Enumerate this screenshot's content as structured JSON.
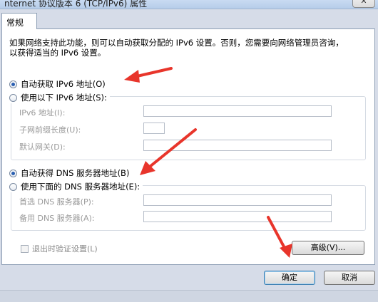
{
  "window": {
    "title": "nternet 协议版本 6 (TCP/IPv6) 属性",
    "close_glyph": "✕"
  },
  "tab": {
    "label": "常规"
  },
  "intro_text": "如果网络支持此功能，则可以自动获取分配的 IPv6 设置。否则，您需要向网络管理员咨询，以获得适当的 IPv6 设置。",
  "ip_section": {
    "auto_label": "自动获取 IPv6 地址(O)",
    "auto_selected": true,
    "manual_label": "使用以下 IPv6 地址(S):",
    "fields": [
      {
        "label": "IPv6 地址(I):",
        "value": ""
      },
      {
        "label": "子网前缀长度(U):",
        "value": ""
      },
      {
        "label": "默认网关(D):",
        "value": ""
      }
    ]
  },
  "dns_section": {
    "auto_label": "自动获得 DNS 服务器地址(B)",
    "auto_selected": true,
    "manual_label": "使用下面的 DNS 服务器地址(E):",
    "fields": [
      {
        "label": "首选 DNS 服务器(P):",
        "value": ""
      },
      {
        "label": "备用 DNS 服务器(A):",
        "value": ""
      }
    ]
  },
  "validate_label": "退出时验证设置(L)",
  "advanced_label": "高级(V)...",
  "ok_label": "确定",
  "cancel_label": "取消",
  "colors": {
    "arrow": "#e8352b",
    "accent": "#2a5fb1"
  }
}
